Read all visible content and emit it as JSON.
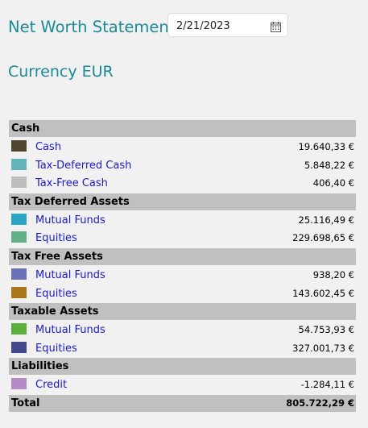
{
  "header": {
    "title": "Net Worth Statement",
    "date_value": "2/21/2023",
    "currency_label": "Currency EUR"
  },
  "sections": [
    {
      "title": "Cash",
      "rows": [
        {
          "label": "Cash",
          "value": "19.640,33 €",
          "color": "#4f452e"
        },
        {
          "label": "Tax-Deferred Cash",
          "value": "5.848,22 €",
          "color": "#63b5b9"
        },
        {
          "label": "Tax-Free Cash",
          "value": "406,40 €",
          "color": "#bcbcbc"
        }
      ]
    },
    {
      "title": "Tax Deferred Assets",
      "rows": [
        {
          "label": "Mutual Funds",
          "value": "25.116,49 €",
          "color": "#2aa5c4"
        },
        {
          "label": "Equities",
          "value": "229.698,65 €",
          "color": "#63b08a"
        }
      ]
    },
    {
      "title": "Tax Free Assets",
      "rows": [
        {
          "label": "Mutual Funds",
          "value": "938,20 €",
          "color": "#6b73b8"
        },
        {
          "label": "Equities",
          "value": "143.602,45 €",
          "color": "#a9761c"
        }
      ]
    },
    {
      "title": "Taxable Assets",
      "rows": [
        {
          "label": "Mutual Funds",
          "value": "54.753,93 €",
          "color": "#5aae3a"
        },
        {
          "label": "Equities",
          "value": "327.001,73 €",
          "color": "#43498d"
        }
      ]
    },
    {
      "title": "Liabilities",
      "rows": [
        {
          "label": "Credit",
          "value": "-1.284,11 €",
          "color": "#b48ac9"
        }
      ]
    }
  ],
  "total": {
    "label": "Total",
    "value": "805.722,29 €"
  }
}
